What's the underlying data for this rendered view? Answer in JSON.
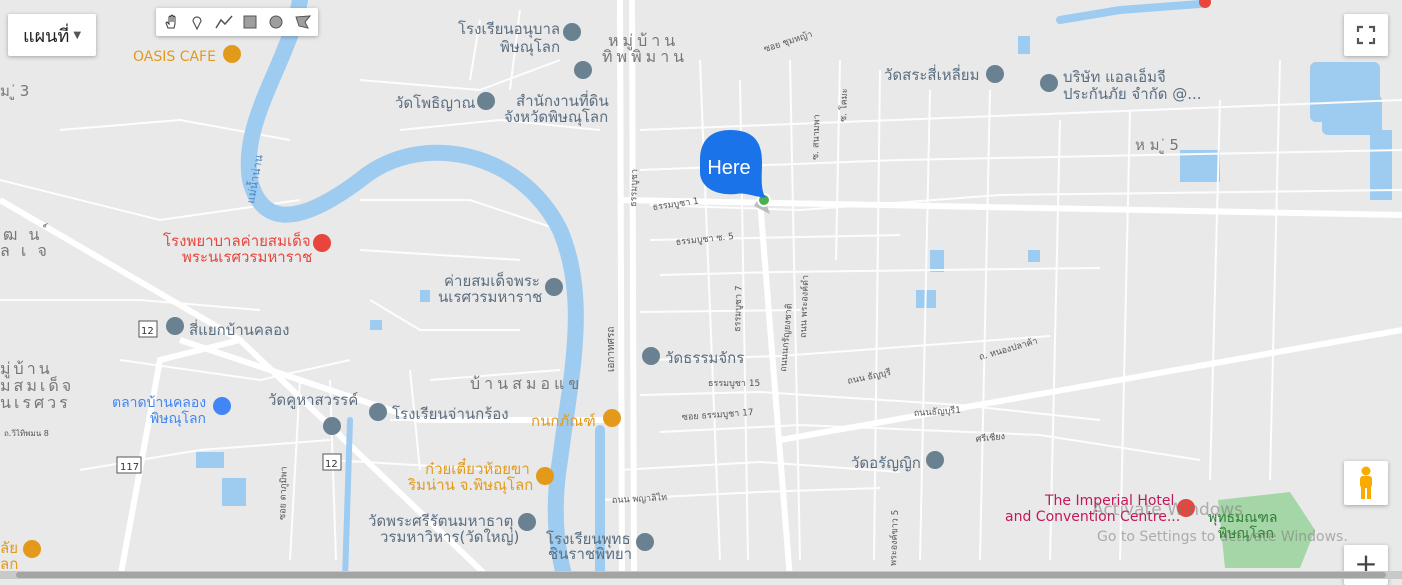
{
  "controls": {
    "map_type_label": "แผนที่",
    "drawing_tools": [
      "hand-icon",
      "marker-icon",
      "polyline-icon",
      "rectangle-icon",
      "circle-icon",
      "polygon-icon"
    ],
    "zoom_in_label": "+"
  },
  "marker": {
    "bubble_text": "Here",
    "bubble_color": "#1a73e8"
  },
  "colors": {
    "river": "#9ecbf0",
    "road_major": "#ffffff",
    "background": "#e9e9e9",
    "poi_red": "#e8453c",
    "poi_orange": "#e39a1b",
    "poi_gray": "#6a8191",
    "poi_pink": "#c2185b"
  },
  "labels": {
    "oasis": "OASIS CAFE",
    "moo3": "ม ู่ 3",
    "school_kinder_1": "โรงเรียนอนุบาล",
    "school_kinder_2": "พิษณุโลก",
    "village_tip_1": "หมู่บ้าน",
    "village_tip_2": "ทิพพิมาน",
    "soi_chumyan": "ซอย ชุมหญ้า",
    "wat_srasi": "วัดสระสี่เหลี่ยม",
    "aia_1": "บริษัท แอลเอ็มจี",
    "aia_2": "ประกันภัย จำกัด @...",
    "wat_potiyan": "วัดโพธิญาณ",
    "land_office_1": "สำนักงานที่ดิน",
    "land_office_2": "จังหวัดพิษณุโลก",
    "moo5": "ห ม ู่ 5",
    "river_nan_1": "แม่น้ำน่าน",
    "thammabucha": "ธรรมบูชา",
    "thammabucha_1": "ธรรมบูชา 1",
    "thammabucha_5": "ธรรมบูชา ซ. 5",
    "wattana_1": "ัฒ น ์",
    "wattana_2": "ล เ จ",
    "hospital_1": "โรงพยาบาลค่ายสมเด็จ",
    "hospital_2": "พระนเรศวรมหาราช",
    "camp_1": "ค่ายสมเด็จพระ",
    "camp_2": "นเรศวรมหาราช",
    "thammabucha_7": "ธรรมบูชา 7",
    "intersection": "สี่แยกบ้านคลอง",
    "route12": "12",
    "wat_thamachak": "วัดธรรมจักร",
    "thammabucha_15": "ธรรมบูชา 15",
    "road_nongplakha": "ถ. หนองปลาค้า",
    "thanon_thanyaburi": "ถนน ธัญบุรี",
    "ekathotsarot": "เอกาทศรถ",
    "village_smd_1": "มู่บ้าน",
    "village_smd_2": "มสมเด็จ",
    "village_smd_3": "นเรศวร",
    "bansamokhae": "บ้านสมอแข",
    "market_1": "ตลาดบ้านคลอง",
    "market_2": "พิษณุโลก",
    "wat_kuhasawan": "วัดคูหาสวรรค์",
    "school_chan": "โรงเรียนจ่านกร้อง",
    "kanokphan": "กนกภัณฑ์",
    "soi_thammabucha_17": "ซอย ธรรมบูชา 17",
    "sriwichai": "ศรีเชียง",
    "thanyaburi_1": "ถนนธัญบุรี1",
    "road_phayalithai": "ถนน พญาลิไท",
    "route117": "117",
    "route12b": "12",
    "noodle_1": "ก๋วยเตี๋ยวห้อยขา",
    "noodle_2": "ริมน่าน จ.พิษณุโลก",
    "wat_ranyik": "วัดอรัญญิก",
    "wat_yai_1": "วัดพระศรีรัตนมหาธาตุ",
    "wat_yai_2": "วรมหาวิหาร(วัดใหญ่)",
    "school_putt_1": "โรงเรียนพุทธ",
    "school_putt_2": "ชินราชพิทยา",
    "imperial_1": "The Imperial Hotel",
    "imperial_2": "and Convention Centre...",
    "park_1": "พุทธมณฑล",
    "park_2": "พิษณุโลก",
    "soi_phra": "พระองค์ขาว 5",
    "thanyaburi_road": "ถนนนกรัญยงชาติ",
    "left_edge_1": "ลัย",
    "left_edge_2": "ลก",
    "yai_8": "ถ.วิไทิพมน 8",
    "phra_ong_dam": "ถนน พระองค์ดำ",
    "soi_kunmai": "ซ. โคมะ",
    "soi_sanumpak": "ซ. สนามพา",
    "soi_sriphum": "ซอย ดาภูมิพา"
  },
  "watermark": {
    "line1": "Activate Windows",
    "line2": "Go to Settings to activate Windows."
  }
}
